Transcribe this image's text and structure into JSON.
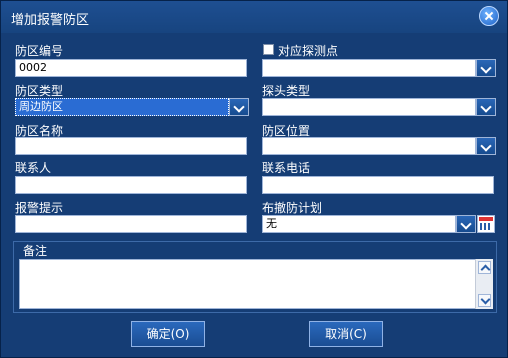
{
  "window": {
    "title": "增加报警防区"
  },
  "form": {
    "zone_number": {
      "label": "防区编号",
      "value": "0002"
    },
    "map_probe_point": {
      "label": "对应探测点",
      "value": ""
    },
    "zone_type": {
      "label": "防区类型",
      "value": "周边防区"
    },
    "probe_type": {
      "label": "探头类型",
      "value": ""
    },
    "zone_name": {
      "label": "防区名称",
      "value": ""
    },
    "zone_location": {
      "label": "防区位置",
      "value": ""
    },
    "contact": {
      "label": "联系人",
      "value": ""
    },
    "contact_phone": {
      "label": "联系电话",
      "value": ""
    },
    "alarm_prompt": {
      "label": "报警提示",
      "value": ""
    },
    "arm_schedule": {
      "label": "布撤防计划",
      "value": "无"
    },
    "remarks": {
      "label": "备注",
      "value": ""
    }
  },
  "buttons": {
    "ok": "确定(O)",
    "cancel": "取消(C)"
  }
}
